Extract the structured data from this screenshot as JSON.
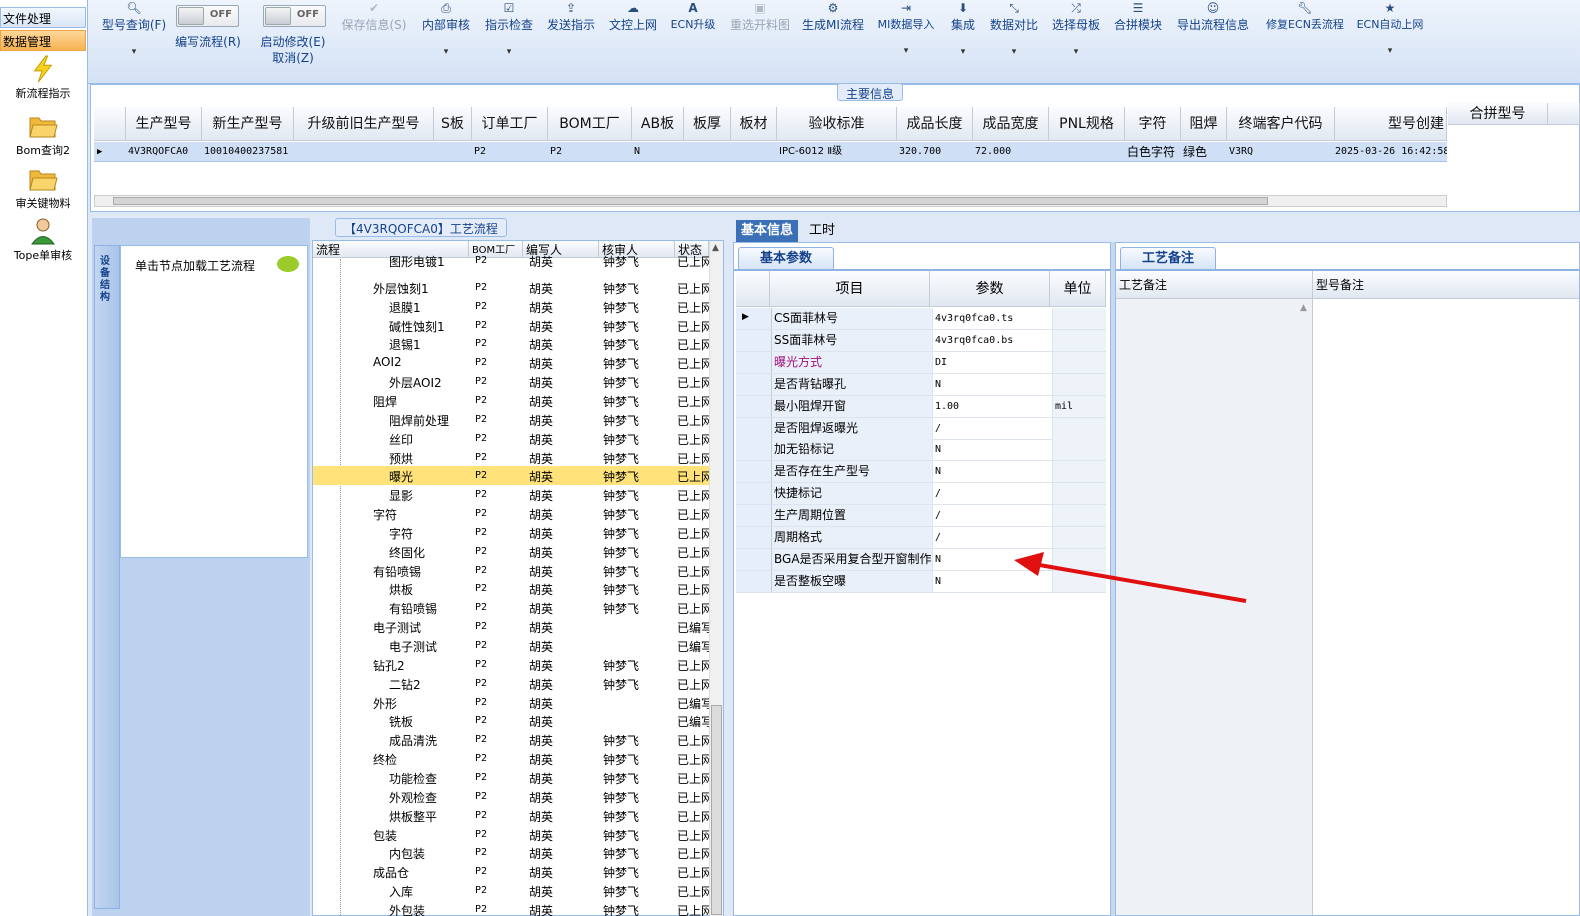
{
  "nav": {
    "header1": "文件处理",
    "header2": "数据管理",
    "items": [
      "新流程指示",
      "Bom查询2",
      "审关键物料",
      "Tope单审核"
    ]
  },
  "toolbar": {
    "buttons": [
      {
        "label": "型号查询(F)",
        "icon": "search-icon",
        "caret": true
      },
      {
        "label": "保存信息(S)",
        "icon": "check-icon",
        "disabled": true
      },
      {
        "label": "内部审核",
        "icon": "printer-icon",
        "caret": true
      },
      {
        "label": "指示检查",
        "icon": "checkbox-icon",
        "caret": true
      },
      {
        "label": "发送指示",
        "icon": "upload-icon"
      },
      {
        "label": "文控上网",
        "icon": "cloud-upload-icon"
      },
      {
        "label": "ECN升级",
        "icon": "text-a-icon"
      },
      {
        "label": "重选开料图",
        "icon": "image-icon",
        "disabled": true
      },
      {
        "label": "生成MI流程",
        "icon": "cogs-icon"
      },
      {
        "label": "MI数据导入",
        "icon": "import-icon",
        "caret": true
      },
      {
        "label": "集成",
        "icon": "download-icon",
        "caret": true
      },
      {
        "label": "数据对比",
        "icon": "compress-icon",
        "caret": true
      },
      {
        "label": "选择母板",
        "icon": "shuffle-icon",
        "caret": true
      },
      {
        "label": "合拼模块",
        "icon": "list-icon"
      },
      {
        "label": "导出流程信息",
        "icon": "smile-icon"
      },
      {
        "label": "修复ECN丢流程",
        "icon": "wrench-icon"
      },
      {
        "label": "ECN自动上网",
        "icon": "star-icon",
        "caret": true
      }
    ],
    "toggle1": {
      "state": "OFF",
      "label": "编写流程(R)"
    },
    "toggle2": {
      "state": "OFF",
      "label": "启动修改(E)",
      "sub": "取消(Z)"
    }
  },
  "main": {
    "group_title": "主要信息",
    "columns": [
      "生产型号",
      "新生产型号",
      "升级前旧生产型号",
      "S板",
      "订单工厂",
      "BOM工厂",
      "AB板",
      "板厚",
      "板材",
      "验收标准",
      "成品长度",
      "成品宽度",
      "PNL规格",
      "字符",
      "阻焊",
      "终端客户代码",
      "型号创建"
    ],
    "row": [
      "4V3RQOFCA0",
      "10010400237581",
      "",
      "",
      "P2",
      "P2",
      "N",
      "",
      "",
      "IPC-6012 Ⅱ级",
      "320.700",
      "72.000",
      "",
      "白色字符",
      "绿色",
      "V3RQ",
      "2025-03-26 16:42:58"
    ],
    "side_header": "合拼型号"
  },
  "flow": {
    "title": "【4V3RQOFCA0】工艺流程",
    "node_hint": "单击节点加载工艺流程",
    "side_tab": "设备结构",
    "columns": [
      "流程",
      "BOM工厂",
      "编写人",
      "核审人",
      "状态"
    ],
    "rows": [
      {
        "name": "图形电镀1",
        "level": 2,
        "bom": "P2",
        "writer": "胡英",
        "reviewer": "钟梦飞",
        "status": "已上网",
        "folder": false,
        "cut": true
      },
      {
        "name": "外层蚀刻1",
        "level": 1,
        "bom": "P2",
        "writer": "胡英",
        "reviewer": "钟梦飞",
        "status": "已上网",
        "folder": true
      },
      {
        "name": "退膜1",
        "level": 2,
        "bom": "P2",
        "writer": "胡英",
        "reviewer": "钟梦飞",
        "status": "已上网"
      },
      {
        "name": "碱性蚀刻1",
        "level": 2,
        "bom": "P2",
        "writer": "胡英",
        "reviewer": "钟梦飞",
        "status": "已上网"
      },
      {
        "name": "退锡1",
        "level": 2,
        "bom": "P2",
        "writer": "胡英",
        "reviewer": "钟梦飞",
        "status": "已上网"
      },
      {
        "name": "AOI2",
        "level": 1,
        "bom": "P2",
        "writer": "胡英",
        "reviewer": "钟梦飞",
        "status": "已上网",
        "folder": true
      },
      {
        "name": "外层AOI2",
        "level": 2,
        "bom": "P2",
        "writer": "胡英",
        "reviewer": "钟梦飞",
        "status": "已上网"
      },
      {
        "name": "阻焊",
        "level": 1,
        "bom": "P2",
        "writer": "胡英",
        "reviewer": "钟梦飞",
        "status": "已上网",
        "folder": true
      },
      {
        "name": "阻焊前处理",
        "level": 2,
        "bom": "P2",
        "writer": "胡英",
        "reviewer": "钟梦飞",
        "status": "已上网"
      },
      {
        "name": "丝印",
        "level": 2,
        "bom": "P2",
        "writer": "胡英",
        "reviewer": "钟梦飞",
        "status": "已上网"
      },
      {
        "name": "预烘",
        "level": 2,
        "bom": "P2",
        "writer": "胡英",
        "reviewer": "钟梦飞",
        "status": "已上网"
      },
      {
        "name": "曝光",
        "level": 2,
        "bom": "P2",
        "writer": "胡英",
        "reviewer": "钟梦飞",
        "status": "已上网",
        "selected": true
      },
      {
        "name": "显影",
        "level": 2,
        "bom": "P2",
        "writer": "胡英",
        "reviewer": "钟梦飞",
        "status": "已上网"
      },
      {
        "name": "字符",
        "level": 1,
        "bom": "P2",
        "writer": "胡英",
        "reviewer": "钟梦飞",
        "status": "已上网",
        "folder": true
      },
      {
        "name": "字符",
        "level": 2,
        "bom": "P2",
        "writer": "胡英",
        "reviewer": "钟梦飞",
        "status": "已上网"
      },
      {
        "name": "终固化",
        "level": 2,
        "bom": "P2",
        "writer": "胡英",
        "reviewer": "钟梦飞",
        "status": "已上网"
      },
      {
        "name": "有铅喷锡",
        "level": 1,
        "bom": "P2",
        "writer": "胡英",
        "reviewer": "钟梦飞",
        "status": "已上网",
        "folder": true
      },
      {
        "name": "烘板",
        "level": 2,
        "bom": "P2",
        "writer": "胡英",
        "reviewer": "钟梦飞",
        "status": "已上网"
      },
      {
        "name": "有铅喷锡",
        "level": 2,
        "bom": "P2",
        "writer": "胡英",
        "reviewer": "钟梦飞",
        "status": "已上网"
      },
      {
        "name": "电子测试",
        "level": 1,
        "bom": "P2",
        "writer": "胡英",
        "reviewer": "",
        "status": "已编写",
        "folder": true
      },
      {
        "name": "电子测试",
        "level": 2,
        "bom": "P2",
        "writer": "胡英",
        "reviewer": "",
        "status": "已编写"
      },
      {
        "name": "钻孔2",
        "level": 1,
        "bom": "P2",
        "writer": "胡英",
        "reviewer": "钟梦飞",
        "status": "已上网",
        "folder": true
      },
      {
        "name": "二钻2",
        "level": 2,
        "bom": "P2",
        "writer": "胡英",
        "reviewer": "钟梦飞",
        "status": "已上网"
      },
      {
        "name": "外形",
        "level": 1,
        "bom": "P2",
        "writer": "胡英",
        "reviewer": "",
        "status": "已编写",
        "folder": true
      },
      {
        "name": "铣板",
        "level": 2,
        "bom": "P2",
        "writer": "胡英",
        "reviewer": "",
        "status": "已编写"
      },
      {
        "name": "成品清洗",
        "level": 2,
        "bom": "P2",
        "writer": "胡英",
        "reviewer": "钟梦飞",
        "status": "已上网"
      },
      {
        "name": "终检",
        "level": 1,
        "bom": "P2",
        "writer": "胡英",
        "reviewer": "钟梦飞",
        "status": "已上网",
        "folder": true
      },
      {
        "name": "功能检查",
        "level": 2,
        "bom": "P2",
        "writer": "胡英",
        "reviewer": "钟梦飞",
        "status": "已上网"
      },
      {
        "name": "外观检查",
        "level": 2,
        "bom": "P2",
        "writer": "胡英",
        "reviewer": "钟梦飞",
        "status": "已上网"
      },
      {
        "name": "烘板整平",
        "level": 2,
        "bom": "P2",
        "writer": "胡英",
        "reviewer": "钟梦飞",
        "status": "已上网"
      },
      {
        "name": "包装",
        "level": 1,
        "bom": "P2",
        "writer": "胡英",
        "reviewer": "钟梦飞",
        "status": "已上网",
        "folder": true
      },
      {
        "name": "内包装",
        "level": 2,
        "bom": "P2",
        "writer": "胡英",
        "reviewer": "钟梦飞",
        "status": "已上网"
      },
      {
        "name": "成品仓",
        "level": 1,
        "bom": "P2",
        "writer": "胡英",
        "reviewer": "钟梦飞",
        "status": "已上网",
        "folder": true
      },
      {
        "name": "入库",
        "level": 2,
        "bom": "P2",
        "writer": "胡英",
        "reviewer": "钟梦飞",
        "status": "已上网"
      },
      {
        "name": "外包装",
        "level": 2,
        "bom": "P2",
        "writer": "胡英",
        "reviewer": "钟梦飞",
        "status": "已上网"
      }
    ]
  },
  "tabs": {
    "basic": "基本信息",
    "hours": "工时"
  },
  "basic": {
    "subtab": "基本参数",
    "columns": [
      "项目",
      "参数",
      "单位"
    ],
    "rows": [
      {
        "item": "CS面菲林号",
        "value": "4v3rq0fca0.ts",
        "unit": ""
      },
      {
        "item": "SS面菲林号",
        "value": "4v3rq0fca0.bs",
        "unit": ""
      },
      {
        "item": "曝光方式",
        "value": "DI",
        "unit": "",
        "highlight": true
      },
      {
        "item": "是否背钻曝孔",
        "value": "N",
        "unit": ""
      },
      {
        "item": "最小阻焊开窗",
        "value": "1.00",
        "unit": "mil"
      },
      {
        "item": "是否阻焊返曝光",
        "value": "/",
        "unit": ""
      },
      {
        "item": "加无铅标记",
        "value": "N",
        "unit": ""
      },
      {
        "item": "是否存在生产型号",
        "value": "N",
        "unit": ""
      },
      {
        "item": "快捷标记",
        "value": "/",
        "unit": ""
      },
      {
        "item": "生产周期位置",
        "value": "/",
        "unit": ""
      },
      {
        "item": "周期格式",
        "value": "/",
        "unit": ""
      },
      {
        "item": "BGA是否采用复合型开窗制作",
        "value": "N",
        "unit": ""
      },
      {
        "item": "是否整板空曝",
        "value": "N",
        "unit": ""
      }
    ]
  },
  "remark": {
    "subtab": "工艺备注",
    "col1": "工艺备注",
    "col2": "型号备注"
  },
  "colors": {
    "accent": "#15428b",
    "selected": "#ffe27a",
    "arrow": "#e01010",
    "highlight_text": "#a0107a"
  }
}
